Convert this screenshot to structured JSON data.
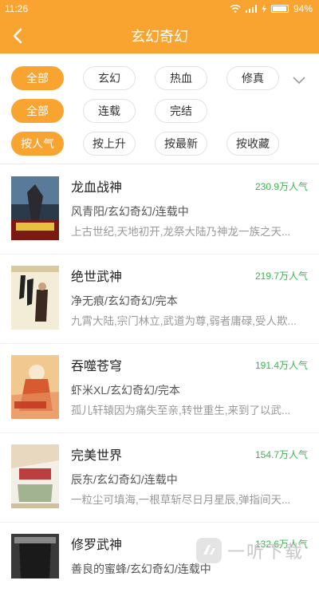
{
  "status_bar": {
    "time": "11:26",
    "battery": "94%"
  },
  "header": {
    "title": "玄幻奇幻"
  },
  "filters": {
    "genre": [
      "全部",
      "玄幻",
      "热血",
      "修真"
    ],
    "status": [
      "全部",
      "连载",
      "完结"
    ],
    "sort": [
      "按人气",
      "按上升",
      "按最新",
      "按收藏"
    ]
  },
  "books": [
    {
      "title": "龙血战神",
      "popularity": "230.9万人气",
      "meta": "风青阳/玄幻奇幻/连载中",
      "desc": "上古世纪,天地初开,龙祭大陆乃神龙一族之天..."
    },
    {
      "title": "绝世武神",
      "popularity": "219.7万人气",
      "meta": "净无痕/玄幻奇幻/完本",
      "desc": "九霄大陆,宗门林立,武道为尊,弱者庸碌,受人欺..."
    },
    {
      "title": "吞噬苍穹",
      "popularity": "191.4万人气",
      "meta": "虾米XL/玄幻奇幻/完本",
      "desc": "孤儿轩辕因为痛失至亲,转世重生,来到了以武..."
    },
    {
      "title": "完美世界",
      "popularity": "154.7万人气",
      "meta": "辰东/玄幻奇幻/连载中",
      "desc": "一粒尘可填海,一根草斩尽日月星辰,弹指间天..."
    },
    {
      "title": "修罗武神",
      "popularity": "132.6万人气",
      "meta": "善良的蜜蜂/玄幻奇幻/连载中",
      "desc": ""
    }
  ],
  "watermark": {
    "text": "一听下载"
  },
  "colors": {
    "accent": "#f9a430",
    "popularity": "#3bb44a"
  }
}
